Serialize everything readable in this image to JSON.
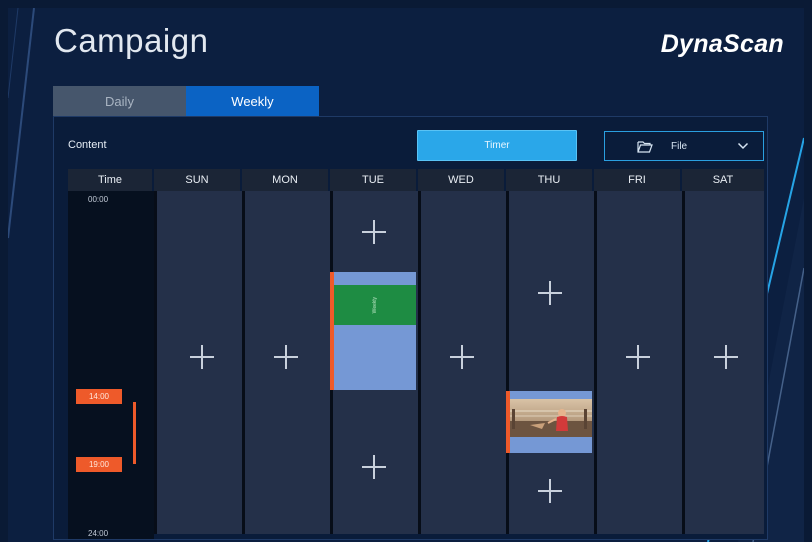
{
  "app": {
    "title": "Campaign",
    "brand": "DynaScan"
  },
  "tabs": [
    {
      "label": "Daily",
      "active": false
    },
    {
      "label": "Weekly",
      "active": true
    }
  ],
  "toolbar": {
    "content_label": "Content",
    "timer_label": "Timer",
    "file_label": "File"
  },
  "schedule": {
    "time_header": "Time",
    "days": [
      "SUN",
      "MON",
      "TUE",
      "WED",
      "THU",
      "FRI",
      "SAT"
    ],
    "time_labels": {
      "start": "00:00",
      "end": "24:00",
      "range_start": "14:00",
      "range_end": "19:00"
    },
    "tue_block_label": "Weekly"
  },
  "colors": {
    "accent": "#2aa7e9",
    "active_tab": "#0b63c4",
    "highlight": "#ee5a2a",
    "scheduled_block": "#7598d5",
    "content_green": "#1e8c43"
  },
  "icons": {
    "add": "plus-icon",
    "folder": "folder-open-icon",
    "dropdown": "chevron-down-icon"
  }
}
